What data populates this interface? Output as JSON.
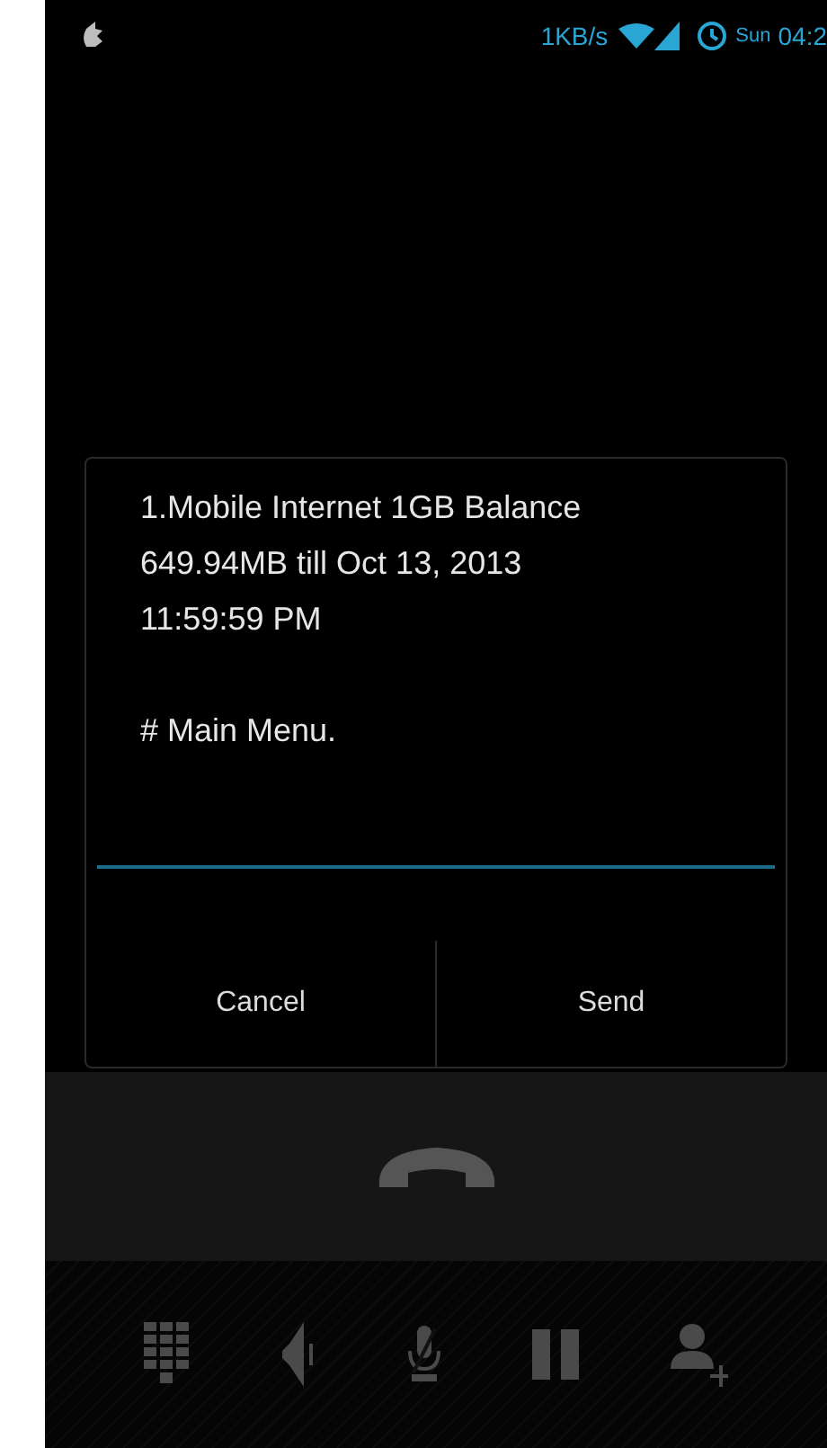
{
  "status_bar": {
    "data_speed": "1KB/s",
    "day": "Sun",
    "time": "04:2"
  },
  "dialog": {
    "message": "1.Mobile Internet 1GB Balance\n649.94MB till Oct 13, 2013\n11:59:59 PM\n\n# Main Menu.",
    "buttons": [
      {
        "label": "Cancel"
      },
      {
        "label": "Send"
      }
    ]
  },
  "call_controls": [
    {
      "kind": "dialpad"
    },
    {
      "kind": "speaker"
    },
    {
      "kind": "mute"
    },
    {
      "kind": "hold"
    },
    {
      "kind": "add_call"
    }
  ]
}
